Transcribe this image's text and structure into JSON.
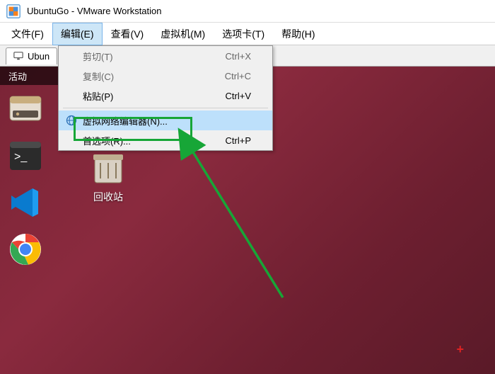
{
  "title": {
    "app_title": "UbuntuGo - VMware Workstation"
  },
  "menu": {
    "file": "文件(F)",
    "edit": "编辑(E)",
    "view": "查看(V)",
    "vm": "虚拟机(M)",
    "tabs": "选项卡(T)",
    "help": "帮助(H)"
  },
  "tab": {
    "label": "Ubun"
  },
  "edit_menu": {
    "cut": {
      "label": "剪切(T)",
      "shortcut": "Ctrl+X"
    },
    "copy": {
      "label": "复制(C)",
      "shortcut": "Ctrl+C"
    },
    "paste": {
      "label": "粘贴(P)",
      "shortcut": "Ctrl+V"
    },
    "vnet": {
      "label": "虚拟网络编辑器(N)..."
    },
    "prefs": {
      "label": "首选项(R)...",
      "shortcut": "Ctrl+P"
    }
  },
  "ubuntu": {
    "activities": "活动",
    "trash_label": "回收站"
  },
  "icons": {
    "vmware": "vmware-logo-icon",
    "monitor": "monitor-icon",
    "globe": "globe-icon",
    "files": "files-icon",
    "terminal": "terminal-icon",
    "vscode": "vscode-icon",
    "chrome": "chrome-icon",
    "trash": "trash-icon"
  }
}
